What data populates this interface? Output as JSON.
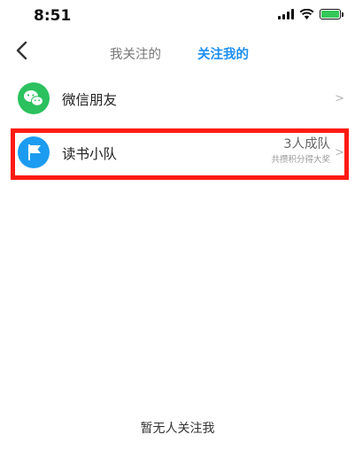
{
  "status_bar": {
    "time": "8:51"
  },
  "nav": {
    "tabs": [
      {
        "label": "我关注的",
        "active": false
      },
      {
        "label": "关注我的",
        "active": true
      }
    ]
  },
  "list": {
    "items": [
      {
        "label": "微信朋友",
        "icon": "wechat-icon"
      },
      {
        "label": "读书小队",
        "icon": "flag-icon",
        "count": "3人成队",
        "hint": "共攒积分得大奖"
      }
    ]
  },
  "empty_state": {
    "text": "暂无人关注我"
  },
  "colors": {
    "accent": "#1e8fef",
    "wechat": "#2bc15e",
    "team": "#1c9cf0",
    "highlight": "#ff1a12"
  }
}
